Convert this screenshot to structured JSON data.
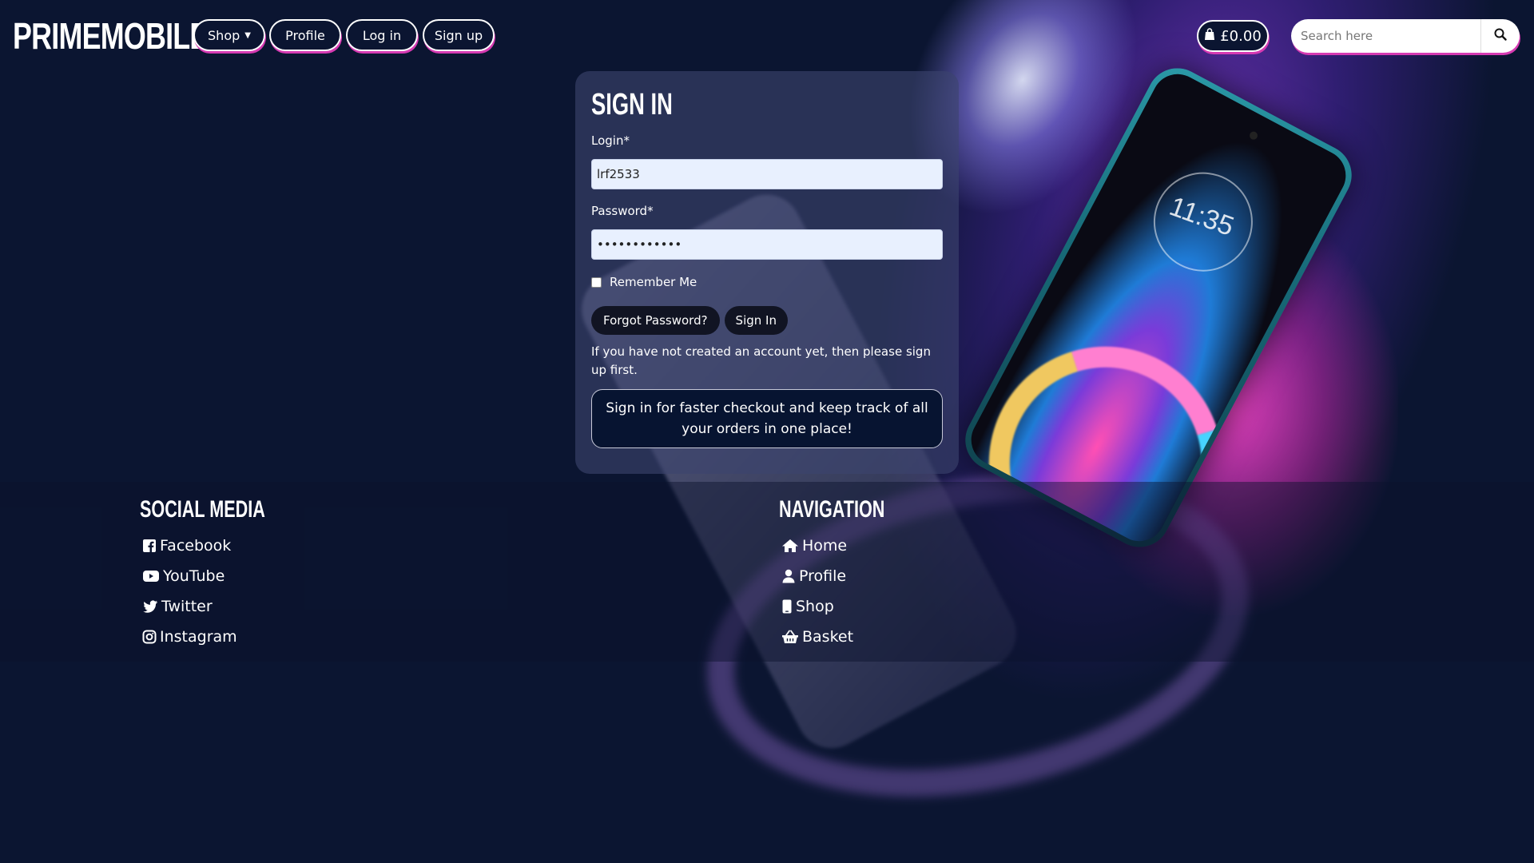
{
  "brand": "PRIMEMOBILE",
  "nav": {
    "shop": "Shop",
    "profile": "Profile",
    "login": "Log in",
    "signup": "Sign up",
    "cart_total": "£0.00",
    "search_placeholder": "Search here"
  },
  "signin": {
    "title": "SIGN IN",
    "login_label": "Login*",
    "login_value": "lrf2533",
    "password_label": "Password*",
    "password_value": "••••••••••••",
    "remember_label": "Remember Me",
    "remember_checked": false,
    "forgot_label": "Forgot Password?",
    "submit_label": "Sign In",
    "hint": "If you have not created an account yet, then please sign up first.",
    "info": "Sign in for faster checkout and keep track of all your orders in one place!"
  },
  "footer": {
    "social_heading": "SOCIAL MEDIA",
    "social": [
      {
        "label": "Facebook",
        "icon": "facebook-icon"
      },
      {
        "label": "YouTube",
        "icon": "youtube-icon"
      },
      {
        "label": "Twitter",
        "icon": "twitter-icon"
      },
      {
        "label": "Instagram",
        "icon": "instagram-icon"
      }
    ],
    "nav_heading": "NAVIGATION",
    "nav": [
      {
        "label": "Home",
        "icon": "home-icon"
      },
      {
        "label": "Profile",
        "icon": "user-icon"
      },
      {
        "label": "Shop",
        "icon": "mobile-icon"
      },
      {
        "label": "Basket",
        "icon": "basket-icon"
      }
    ]
  },
  "colors": {
    "background": "#0b1531",
    "accent": "#d63ab2",
    "card": "#3c446e",
    "info_box": "#071431"
  }
}
